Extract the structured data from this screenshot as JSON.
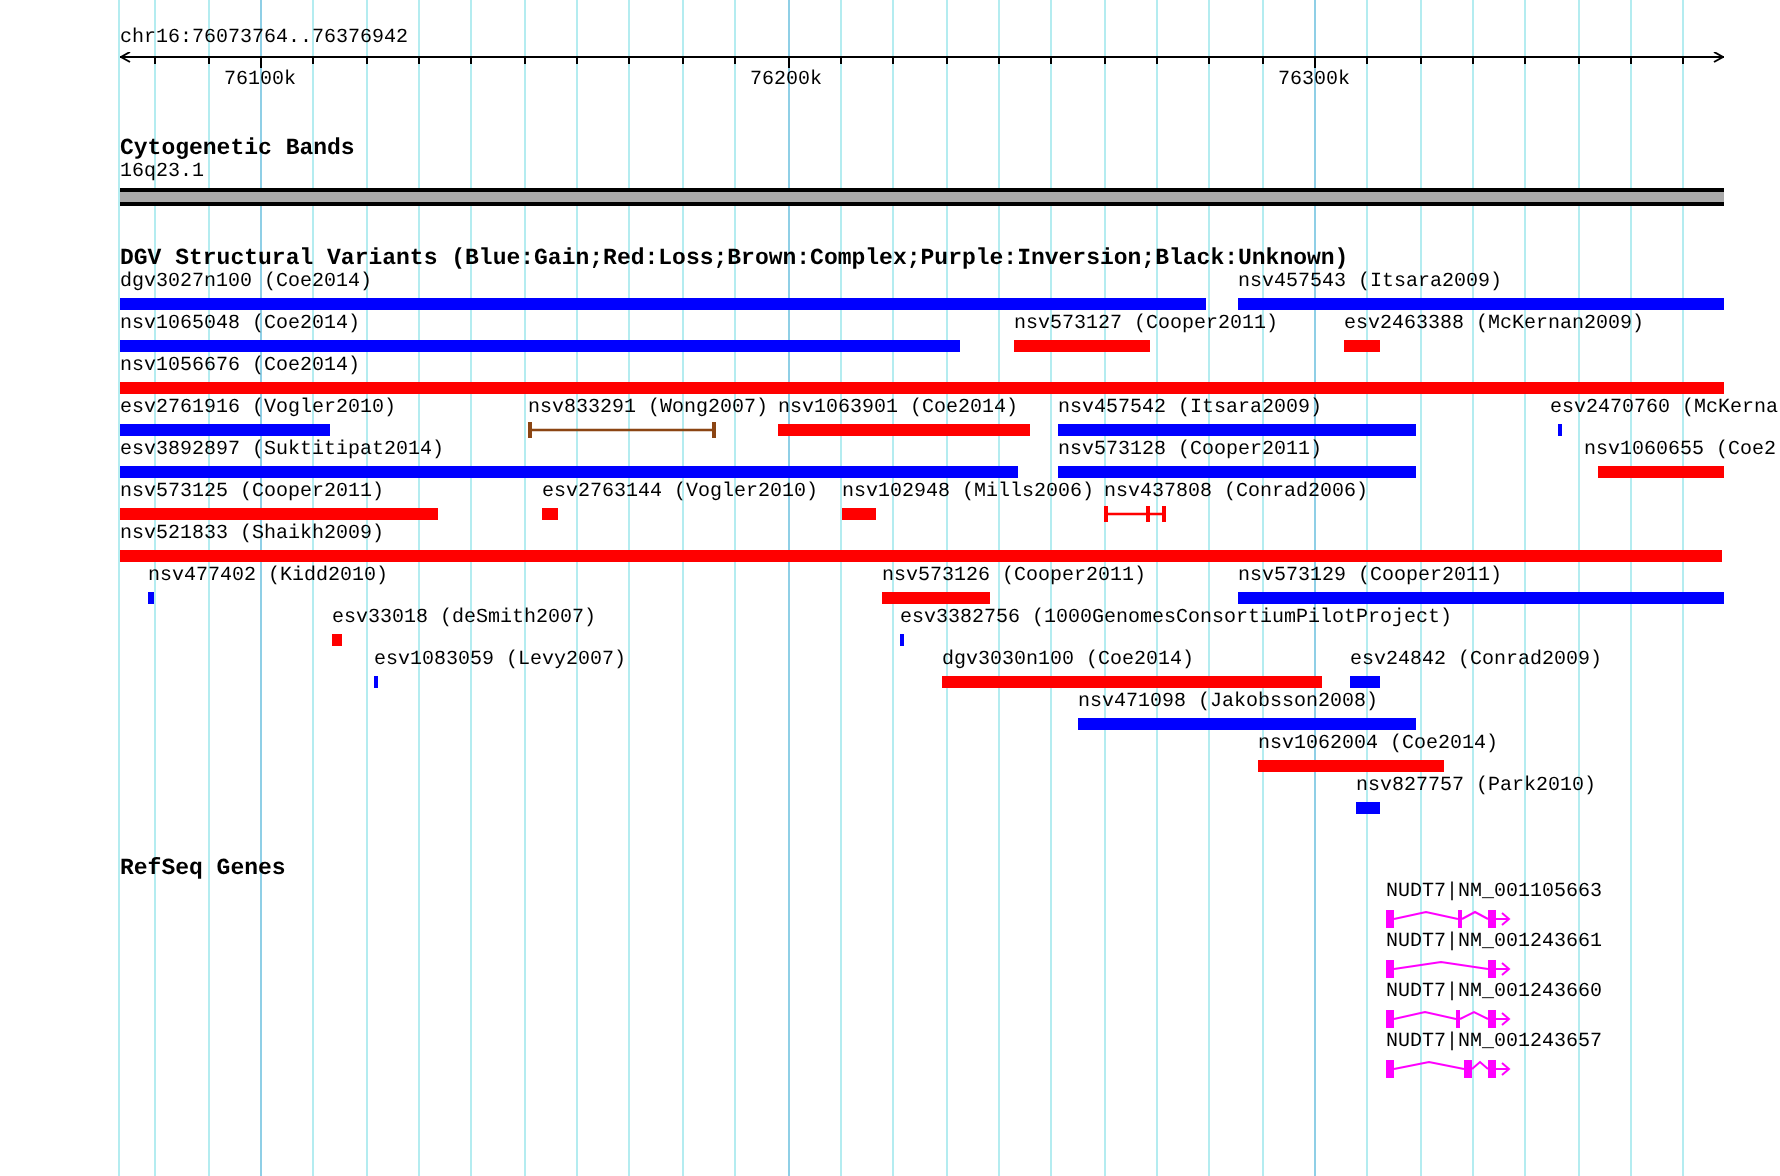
{
  "ruler": {
    "region": "chr16:76073764..76376942",
    "ticks": [
      "76100k",
      "76200k",
      "76300k"
    ]
  },
  "cytoband_track": {
    "title": "Cytogenetic Bands",
    "band": "16q23.1"
  },
  "variant_track": {
    "title": "DGV Structural Variants (Blue:Gain;Red:Loss;Brown:Complex;Purple:Inversion;Black:Unknown)",
    "rows": [
      [
        {
          "label": "dgv3027n100 (Coe2014)",
          "color": "#0000ff"
        },
        {
          "label": "nsv457543 (Itsara2009)",
          "color": "#0000ff"
        }
      ],
      [
        {
          "label": "nsv1065048 (Coe2014)",
          "color": "#0000ff"
        },
        {
          "label": "nsv573127 (Cooper2011)",
          "color": "#ff0000"
        },
        {
          "label": "esv2463388 (McKernan2009)",
          "color": "#ff0000"
        }
      ],
      [
        {
          "label": "nsv1056676 (Coe2014)",
          "color": "#ff0000"
        }
      ],
      [
        {
          "label": "esv2761916 (Vogler2010)",
          "color": "#0000ff"
        },
        {
          "label": "nsv833291 (Wong2007)",
          "color": "#8b4513"
        },
        {
          "label": "nsv1063901 (Coe2014)",
          "color": "#ff0000"
        },
        {
          "label": "nsv457542 (Itsara2009)",
          "color": "#0000ff"
        },
        {
          "label": "esv2470760 (McKerna",
          "color": "#0000ff"
        }
      ],
      [
        {
          "label": "esv3892897 (Suktitipat2014)",
          "color": "#0000ff"
        },
        {
          "label": "nsv573128 (Cooper2011)",
          "color": "#0000ff"
        },
        {
          "label": "nsv1060655 (Coe2",
          "color": "#ff0000"
        }
      ],
      [
        {
          "label": "nsv573125 (Cooper2011)",
          "color": "#ff0000"
        },
        {
          "label": "esv2763144 (Vogler2010)",
          "color": "#ff0000"
        },
        {
          "label": "nsv102948 (Mills2006)",
          "color": "#ff0000"
        },
        {
          "label": "nsv437808 (Conrad2006)",
          "color": "#ff0000"
        }
      ],
      [
        {
          "label": "nsv521833 (Shaikh2009)",
          "color": "#ff0000"
        }
      ],
      [
        {
          "label": "nsv477402 (Kidd2010)",
          "color": "#0000ff"
        },
        {
          "label": "nsv573126 (Cooper2011)",
          "color": "#ff0000"
        },
        {
          "label": "nsv573129 (Cooper2011)",
          "color": "#0000ff"
        }
      ],
      [
        {
          "label": "esv33018 (deSmith2007)",
          "color": "#ff0000"
        },
        {
          "label": "esv3382756 (1000GenomesConsortiumPilotProject)",
          "color": "#0000ff"
        }
      ],
      [
        {
          "label": "esv1083059 (Levy2007)",
          "color": "#0000ff"
        },
        {
          "label": "dgv3030n100 (Coe2014)",
          "color": "#ff0000"
        },
        {
          "label": "esv24842 (Conrad2009)",
          "color": "#0000ff"
        }
      ],
      [
        {
          "label": "nsv471098 (Jakobsson2008)",
          "color": "#0000ff"
        }
      ],
      [
        {
          "label": "nsv1062004 (Coe2014)",
          "color": "#ff0000"
        }
      ],
      [
        {
          "label": "nsv827757 (Park2010)",
          "color": "#0000ff"
        }
      ]
    ]
  },
  "gene_track": {
    "title": "RefSeq Genes",
    "transcripts": [
      "NUDT7|NM_001105663",
      "NUDT7|NM_001243661",
      "NUDT7|NM_001243660",
      "NUDT7|NM_001243657"
    ]
  }
}
